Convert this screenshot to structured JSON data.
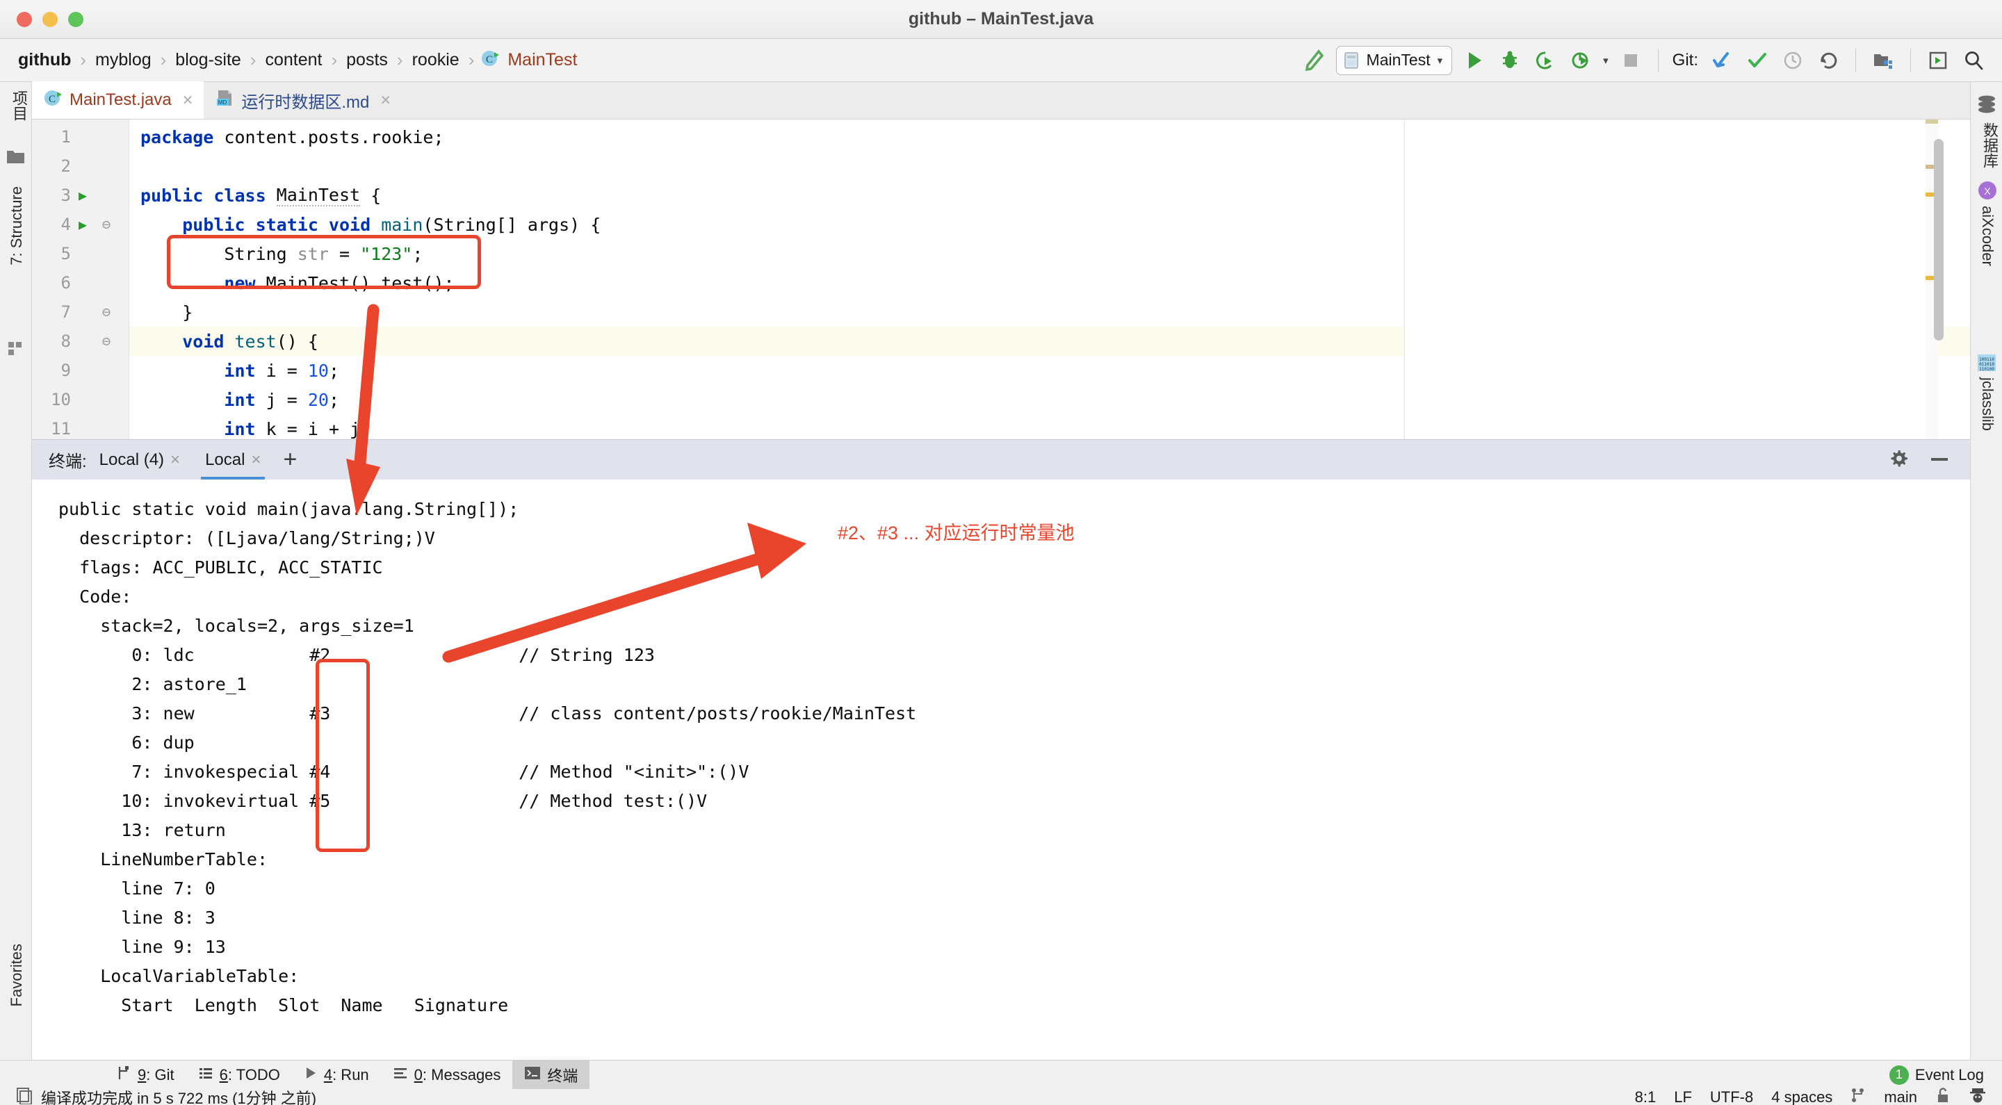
{
  "window": {
    "title": "github – MainTest.java"
  },
  "breadcrumb": {
    "items": [
      {
        "label": "github",
        "kind": "root"
      },
      {
        "label": "myblog",
        "kind": "dir"
      },
      {
        "label": "blog-site",
        "kind": "dir"
      },
      {
        "label": "content",
        "kind": "dir"
      },
      {
        "label": "posts",
        "kind": "dir"
      },
      {
        "label": "rookie",
        "kind": "dir"
      },
      {
        "label": "MainTest",
        "kind": "file"
      }
    ],
    "separator": "›"
  },
  "toolbar": {
    "build_icon": "hammer-icon",
    "run_config": "MainTest",
    "run_config_caret": "▾",
    "run_icon": "run-icon",
    "debug_icon": "debug-icon",
    "run_coverage_icon": "run-with-coverage-icon",
    "profiler_icon": "profiler-icon",
    "profiler_caret": "▾",
    "stop_icon": "stop-icon",
    "git_label": "Git:",
    "update_icon": "git-update-icon",
    "commit_icon": "git-commit-icon",
    "history_icon": "git-history-icon",
    "rollback_icon": "git-rollback-icon",
    "project_structure_icon": "project-structure-icon",
    "plugins_icon": "plugins-icon",
    "search_icon": "search-everywhere-icon"
  },
  "rails": {
    "left": [
      {
        "label": "项目",
        "icon": "project-folder-icon"
      },
      {
        "label": "7: Structure",
        "icon": "structure-icon"
      }
    ],
    "left_bottom": [
      {
        "label": "Favorites",
        "icon": "star-icon"
      }
    ],
    "right": [
      {
        "label": "数据库",
        "icon": "database-icon"
      },
      {
        "label": "aiXcoder",
        "icon": "aixcoder-icon"
      },
      {
        "label": "jclasslib",
        "icon": "jclasslib-icon"
      }
    ]
  },
  "editor_tabs": [
    {
      "label": "MainTest.java",
      "icon": "java-class-icon",
      "active": true,
      "close": "×"
    },
    {
      "label": "运行时数据区.md",
      "icon": "markdown-icon",
      "active": false,
      "close": "×"
    }
  ],
  "editor": {
    "lines": [
      {
        "n": "1",
        "run": false,
        "fold": "",
        "hl": false,
        "tokens": [
          {
            "t": "package ",
            "c": "kw"
          },
          {
            "t": "content.posts.rookie;",
            "c": "plain"
          }
        ]
      },
      {
        "n": "2",
        "run": false,
        "fold": "",
        "hl": false,
        "tokens": []
      },
      {
        "n": "3",
        "run": true,
        "fold": "",
        "hl": false,
        "tokens": [
          {
            "t": "public class ",
            "c": "kw"
          },
          {
            "t": "MainTest",
            "c": "typo"
          },
          {
            "t": " {",
            "c": "plain"
          }
        ]
      },
      {
        "n": "4",
        "run": true,
        "fold": "⊖",
        "hl": false,
        "tokens": [
          {
            "t": "    ",
            "c": "plain"
          },
          {
            "t": "public static void ",
            "c": "kw"
          },
          {
            "t": "main",
            "c": "mth"
          },
          {
            "t": "(String[] args) {",
            "c": "plain"
          }
        ]
      },
      {
        "n": "5",
        "run": false,
        "fold": "",
        "hl": false,
        "tokens": [
          {
            "t": "        String ",
            "c": "plain"
          },
          {
            "t": "str",
            "c": "fld"
          },
          {
            "t": " = ",
            "c": "plain"
          },
          {
            "t": "\"123\"",
            "c": "str"
          },
          {
            "t": ";",
            "c": "plain"
          }
        ]
      },
      {
        "n": "6",
        "run": false,
        "fold": "",
        "hl": false,
        "tokens": [
          {
            "t": "        ",
            "c": "plain"
          },
          {
            "t": "new ",
            "c": "kw"
          },
          {
            "t": "MainTest().test();",
            "c": "plain"
          }
        ]
      },
      {
        "n": "7",
        "run": false,
        "fold": "⊖",
        "hl": false,
        "tokens": [
          {
            "t": "    }",
            "c": "plain"
          }
        ]
      },
      {
        "n": "8",
        "run": false,
        "fold": "⊖",
        "hl": true,
        "tokens": [
          {
            "t": "    ",
            "c": "plain"
          },
          {
            "t": "void ",
            "c": "kw"
          },
          {
            "t": "test",
            "c": "mth"
          },
          {
            "t": "() {",
            "c": "plain"
          }
        ]
      },
      {
        "n": "9",
        "run": false,
        "fold": "",
        "hl": false,
        "tokens": [
          {
            "t": "        ",
            "c": "plain"
          },
          {
            "t": "int ",
            "c": "kw"
          },
          {
            "t": "i = ",
            "c": "plain"
          },
          {
            "t": "10",
            "c": "num"
          },
          {
            "t": ";",
            "c": "plain"
          }
        ]
      },
      {
        "n": "10",
        "run": false,
        "fold": "",
        "hl": false,
        "tokens": [
          {
            "t": "        ",
            "c": "plain"
          },
          {
            "t": "int ",
            "c": "kw"
          },
          {
            "t": "j = ",
            "c": "plain"
          },
          {
            "t": "20",
            "c": "num"
          },
          {
            "t": ";",
            "c": "plain"
          }
        ]
      },
      {
        "n": "11",
        "run": false,
        "fold": "",
        "hl": false,
        "tokens": [
          {
            "t": "        ",
            "c": "plain"
          },
          {
            "t": "int ",
            "c": "kw"
          },
          {
            "t": "k = i + j",
            "c": "plain"
          }
        ]
      }
    ]
  },
  "terminal": {
    "label": "终端:",
    "tabs": [
      {
        "label": "Local (4)",
        "active": false,
        "close": "×"
      },
      {
        "label": "Local",
        "active": true,
        "close": "×"
      }
    ],
    "add_button": "+",
    "settings_icon": "gear-icon",
    "minimize_icon": "minimize-icon",
    "output": [
      "public static void main(java.lang.String[]);",
      "  descriptor: ([Ljava/lang/String;)V",
      "  flags: ACC_PUBLIC, ACC_STATIC",
      "  Code:",
      "    stack=2, locals=2, args_size=1",
      "       0: ldc           #2                  // String 123",
      "       2: astore_1",
      "       3: new           #3                  // class content/posts/rookie/MainTest",
      "       6: dup",
      "       7: invokespecial #4                  // Method \"<init>\":()V",
      "      10: invokevirtual #5                  // Method test:()V",
      "      13: return",
      "    LineNumberTable:",
      "      line 7: 0",
      "      line 8: 3",
      "      line 9: 13",
      "    LocalVariableTable:",
      "      Start  Length  Slot  Name   Signature"
    ]
  },
  "annotations": {
    "code_box_label": "code-highlight-box",
    "constant_pool_box_label": "constant-pool-refs-box",
    "note": "#2、#3 ...  对应运行时常量池",
    "color": "#e8452c"
  },
  "bottom_tools": [
    {
      "num": "9",
      "label": ": Git",
      "icon": "git-branch-icon",
      "active": false
    },
    {
      "num": "6",
      "label": ": TODO",
      "icon": "todo-icon",
      "active": false
    },
    {
      "num": "4",
      "label": ": Run",
      "icon": "run-small-icon",
      "active": false
    },
    {
      "num": "0",
      "label": ": Messages",
      "icon": "messages-icon",
      "active": false
    },
    {
      "num": "",
      "label": "终端",
      "icon": "terminal-icon",
      "active": true
    }
  ],
  "event_log": {
    "count": "1",
    "label": "Event Log"
  },
  "status": {
    "message": "编译成功完成 in 5 s 722 ms (1分钟 之前)",
    "message_icon": "build-status-icon",
    "caret": "8:1",
    "line_sep": "LF",
    "encoding": "UTF-8",
    "indent": "4 spaces",
    "branch_icon": "git-branch-icon",
    "branch": "main",
    "lock_icon": "unlocked-icon",
    "inspector_icon": "hector-icon"
  }
}
